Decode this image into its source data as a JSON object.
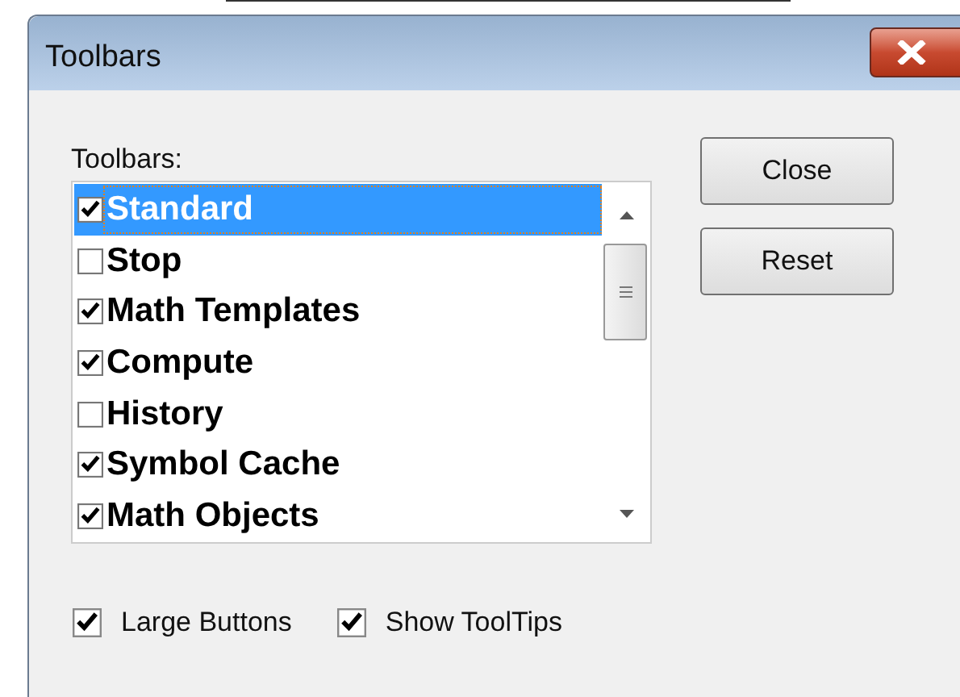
{
  "window": {
    "title": "Toolbars"
  },
  "list_label": "Toolbars:",
  "toolbars": [
    {
      "label": "Standard",
      "checked": true,
      "selected": true
    },
    {
      "label": "Stop",
      "checked": false,
      "selected": false
    },
    {
      "label": "Math Templates",
      "checked": true,
      "selected": false
    },
    {
      "label": "Compute",
      "checked": true,
      "selected": false
    },
    {
      "label": "History",
      "checked": false,
      "selected": false
    },
    {
      "label": "Symbol Cache",
      "checked": true,
      "selected": false
    },
    {
      "label": "Math Objects",
      "checked": true,
      "selected": false
    }
  ],
  "buttons": [
    "Close",
    "Reset"
  ],
  "options": [
    {
      "label": "Large Buttons",
      "checked": true
    },
    {
      "label": "Show ToolTips",
      "checked": true
    }
  ]
}
